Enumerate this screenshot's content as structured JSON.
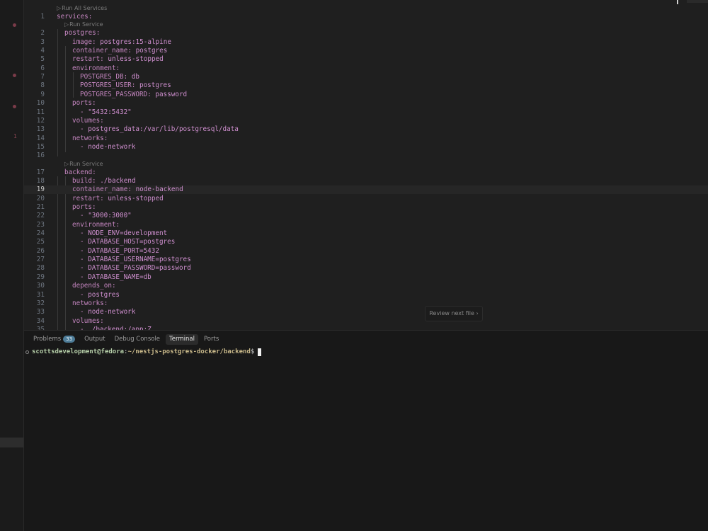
{
  "editor": {
    "codelens": {
      "run_all": "Run All Services",
      "run_service": "Run Service"
    },
    "current_line": 19,
    "lines": [
      {
        "n": "1",
        "indent": 0,
        "key": "services:",
        "val": ""
      },
      {
        "n": "2",
        "indent": 1,
        "key": "postgres:",
        "val": ""
      },
      {
        "n": "3",
        "indent": 2,
        "key": "image: ",
        "val": "postgres:15-alpine"
      },
      {
        "n": "4",
        "indent": 2,
        "key": "container_name: ",
        "val": "postgres"
      },
      {
        "n": "5",
        "indent": 2,
        "key": "restart: ",
        "val": "unless-stopped"
      },
      {
        "n": "6",
        "indent": 2,
        "key": "environment:",
        "val": ""
      },
      {
        "n": "7",
        "indent": 3,
        "key": "POSTGRES_DB: ",
        "val": "db"
      },
      {
        "n": "8",
        "indent": 3,
        "key": "POSTGRES_USER: ",
        "val": "postgres"
      },
      {
        "n": "9",
        "indent": 3,
        "key": "POSTGRES_PASSWORD: ",
        "val": "password"
      },
      {
        "n": "10",
        "indent": 2,
        "key": "ports:",
        "val": ""
      },
      {
        "n": "11",
        "indent": 3,
        "key": "- ",
        "val": "\"5432:5432\""
      },
      {
        "n": "12",
        "indent": 2,
        "key": "volumes:",
        "val": ""
      },
      {
        "n": "13",
        "indent": 3,
        "key": "- ",
        "val": "postgres_data:/var/lib/postgresql/data"
      },
      {
        "n": "14",
        "indent": 2,
        "key": "networks:",
        "val": ""
      },
      {
        "n": "15",
        "indent": 3,
        "key": "- ",
        "val": "node-network"
      },
      {
        "n": "16",
        "indent": 0,
        "key": "",
        "val": ""
      },
      {
        "n": "17",
        "indent": 1,
        "key": "backend:",
        "val": ""
      },
      {
        "n": "18",
        "indent": 2,
        "key": "build: ",
        "val": "./backend"
      },
      {
        "n": "19",
        "indent": 2,
        "key": "container_name: ",
        "val": "node-backend"
      },
      {
        "n": "20",
        "indent": 2,
        "key": "restart: ",
        "val": "unless-stopped"
      },
      {
        "n": "21",
        "indent": 2,
        "key": "ports:",
        "val": ""
      },
      {
        "n": "22",
        "indent": 3,
        "key": "- ",
        "val": "\"3000:3000\""
      },
      {
        "n": "23",
        "indent": 2,
        "key": "environment:",
        "val": ""
      },
      {
        "n": "24",
        "indent": 3,
        "key": "- ",
        "val": "NODE_ENV=development"
      },
      {
        "n": "25",
        "indent": 3,
        "key": "- ",
        "val": "DATABASE_HOST=postgres"
      },
      {
        "n": "26",
        "indent": 3,
        "key": "- ",
        "val": "DATABASE_PORT=5432"
      },
      {
        "n": "27",
        "indent": 3,
        "key": "- ",
        "val": "DATABASE_USERNAME=postgres"
      },
      {
        "n": "28",
        "indent": 3,
        "key": "- ",
        "val": "DATABASE_PASSWORD=password"
      },
      {
        "n": "29",
        "indent": 3,
        "key": "- ",
        "val": "DATABASE_NAME=db"
      },
      {
        "n": "30",
        "indent": 2,
        "key": "depends_on:",
        "val": ""
      },
      {
        "n": "31",
        "indent": 3,
        "key": "- ",
        "val": "postgres"
      },
      {
        "n": "32",
        "indent": 2,
        "key": "networks:",
        "val": ""
      },
      {
        "n": "33",
        "indent": 3,
        "key": "- ",
        "val": "node-network"
      },
      {
        "n": "34",
        "indent": 2,
        "key": "volumes:",
        "val": ""
      },
      {
        "n": "35",
        "indent": 3,
        "key": "- ",
        "val": "./backend:/app:Z"
      }
    ],
    "review_next_file": "Review next file ›"
  },
  "gutter": {
    "problem_count_marker": "1"
  },
  "panel": {
    "tabs": [
      {
        "label": "Problems",
        "badge": "33",
        "active": false
      },
      {
        "label": "Output",
        "badge": "",
        "active": false
      },
      {
        "label": "Debug Console",
        "badge": "",
        "active": false
      },
      {
        "label": "Terminal",
        "badge": "",
        "active": true
      },
      {
        "label": "Ports",
        "badge": "",
        "active": false
      }
    ],
    "terminal": {
      "user_host": "scottsdevelopment@fedora",
      "separator": ":",
      "path": "~/nestjs-postgres-docker/backend",
      "prompt": "$"
    }
  }
}
